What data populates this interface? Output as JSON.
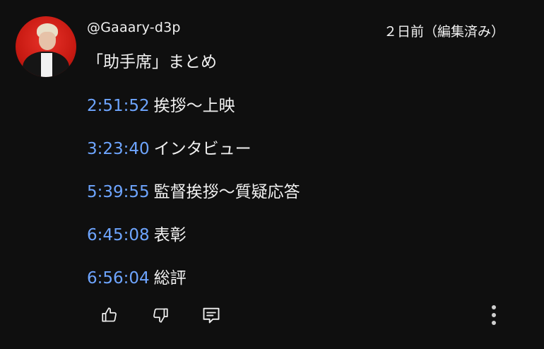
{
  "comment": {
    "handle": "@Gaaary-d3p",
    "time_ago": "２日前（編集済み）",
    "title": "「助手席」まとめ",
    "chapters": [
      {
        "timestamp": "2:51:52",
        "label": "挨拶〜上映"
      },
      {
        "timestamp": "3:23:40",
        "label": "インタビュー"
      },
      {
        "timestamp": "5:39:55",
        "label": "監督挨拶〜質疑応答"
      },
      {
        "timestamp": "6:45:08",
        "label": "表彰"
      },
      {
        "timestamp": "6:56:04",
        "label": "総評"
      }
    ]
  },
  "actions": {
    "like_icon": "thumbs-up-icon",
    "dislike_icon": "thumbs-down-icon",
    "reply_icon": "reply-comment-icon",
    "more_icon": "more-vertical-icon"
  },
  "colors": {
    "background": "#0f0f0f",
    "text": "#f1f1f1",
    "timestamp_link": "#6ea5ff",
    "avatar_bg": "#c81a12"
  }
}
